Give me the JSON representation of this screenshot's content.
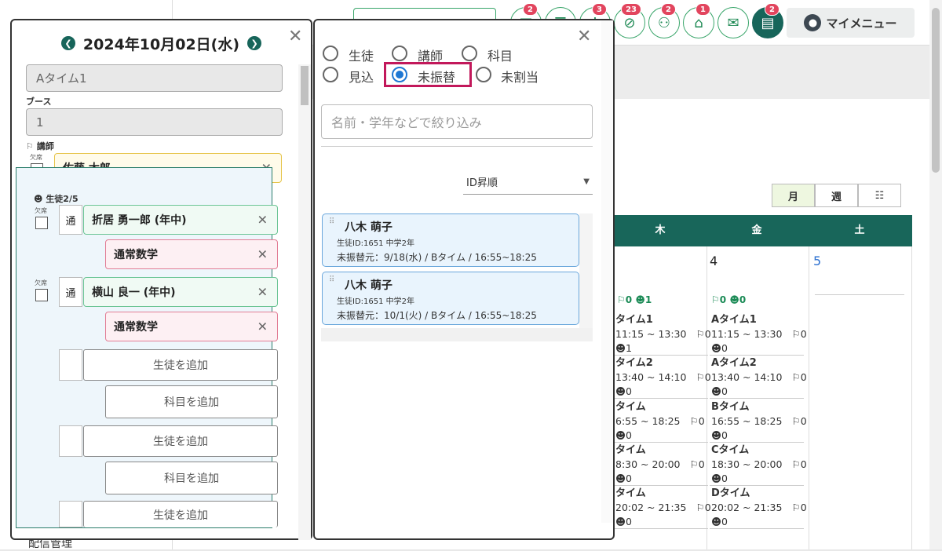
{
  "header": {
    "badges": [
      "2",
      "3",
      "23",
      "2",
      "1",
      "2"
    ],
    "my_menu": "マイメニュー"
  },
  "bottom_nav": {
    "label": "配信管理"
  },
  "calendar": {
    "view_buttons": {
      "month": "月",
      "week": "週"
    },
    "day_headers": [
      "木",
      "金",
      "土"
    ],
    "dates": [
      "4",
      "5"
    ],
    "counts": {
      "thu_student": "1",
      "thu_teacher": "0",
      "fri_teacher": "0",
      "fri_student": "0"
    },
    "thu_slots": [
      {
        "name": "タイム1",
        "time": "11:15 ~ 13:30",
        "t": "0",
        "s": "1"
      },
      {
        "name": "タイム2",
        "time": "13:40 ~ 14:10",
        "t": "0",
        "s": "0"
      },
      {
        "name": "タイム",
        "time": "6:55 ~ 18:25",
        "t": "0",
        "s": "0"
      },
      {
        "name": "タイム",
        "time": "8:30 ~ 20:00",
        "t": "0",
        "s": "0"
      },
      {
        "name": "タイム",
        "time": "20:02 ~ 21:35",
        "t": "0",
        "s": "0"
      }
    ],
    "fri_slots": [
      {
        "name": "Aタイム1",
        "time": "11:15 ~ 13:30",
        "t": "0",
        "s": "0"
      },
      {
        "name": "Aタイム2",
        "time": "13:40 ~ 14:10",
        "t": "0",
        "s": "0"
      },
      {
        "name": "Bタイム",
        "time": "16:55 ~ 18:25",
        "t": "0",
        "s": "0"
      },
      {
        "name": "Cタイム",
        "time": "18:30 ~ 20:00",
        "t": "0",
        "s": "0"
      },
      {
        "name": "Dタイム",
        "time": "20:02 ~ 21:35",
        "t": "0",
        "s": "0"
      }
    ]
  },
  "left_panel": {
    "date_title": "2024年10月02日(水)",
    "time_slot_value": "Aタイム1",
    "booth_label": "ブース",
    "booth_value": "1",
    "teacher_label": "講師",
    "absent_label": "欠席",
    "teacher_name": "佐藤 太郎",
    "students_label": "生徒2/5",
    "students": [
      {
        "type": "通",
        "name": "折居 勇一郎 (年中)",
        "subject": "通常数学"
      },
      {
        "type": "通",
        "name": "横山 良一 (年中)",
        "subject": "通常数学"
      }
    ],
    "add_student": "生徒を追加",
    "add_subject": "科目を追加"
  },
  "right_panel": {
    "radios": [
      "生徒",
      "講師",
      "科目",
      "見込",
      "未振替",
      "未割当"
    ],
    "selected_radio": "未振替",
    "search_placeholder": "名前・学年などで絞り込み",
    "sort_label": "ID昇順",
    "results": [
      {
        "name": "八木 萌子",
        "info": "生徒ID:1651 中学2年",
        "transfer": "未振替元：9/18(水) / Bタイム / 16:55~18:25"
      },
      {
        "name": "八木 萌子",
        "info": "生徒ID:1651 中学2年",
        "transfer": "未振替元：10/1(火) / Bタイム / 16:55~18:25"
      }
    ]
  }
}
